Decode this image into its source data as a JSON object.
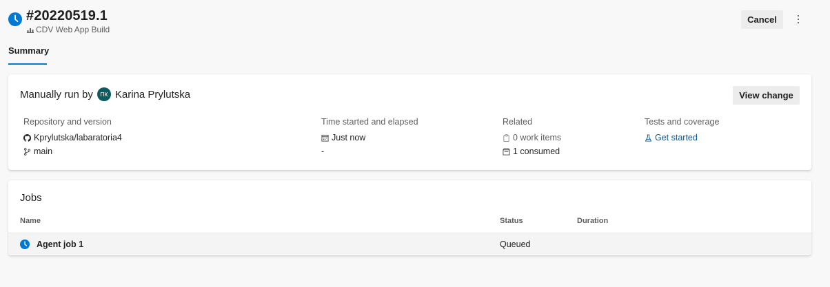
{
  "header": {
    "run_number": "#20220519.1",
    "pipeline_name": "CDV Web App Build",
    "cancel_label": "Cancel",
    "more_icon": "more-vertical-icon"
  },
  "tabs": [
    {
      "label": "Summary",
      "selected": true
    }
  ],
  "summary": {
    "trigger_prefix": "Manually run by",
    "user_initials": "ПК",
    "user_name": "Karina Prylutska",
    "view_change_label": "View change",
    "repository": {
      "label": "Repository and version",
      "repo": "Kprylutska/labaratoria4",
      "branch": "main"
    },
    "time": {
      "label": "Time started and elapsed",
      "started": "Just now",
      "elapsed": "-"
    },
    "related": {
      "label": "Related",
      "work_items": "0 work items",
      "consumed": "1 consumed"
    },
    "tests": {
      "label": "Tests and coverage",
      "link": "Get started"
    }
  },
  "jobs": {
    "title": "Jobs",
    "columns": [
      "Name",
      "Status",
      "Duration"
    ],
    "rows": [
      {
        "name": "Agent job 1",
        "status": "Queued",
        "duration": ""
      }
    ]
  },
  "colors": {
    "accent": "#0078d4",
    "queued": "#0078d4",
    "avatar": "#0e5a5e",
    "link": "#005a9e"
  }
}
